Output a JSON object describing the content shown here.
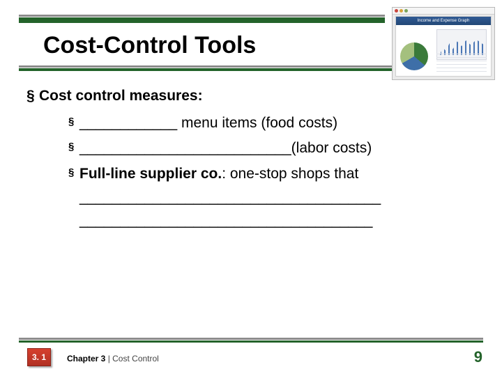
{
  "title": "Cost-Control Tools",
  "corner_image": {
    "window_title": "Income and Expense Graph"
  },
  "body": {
    "heading": "Cost control measures:",
    "items": [
      {
        "blank": "____________",
        "text_after": " menu items (food costs)"
      },
      {
        "blank": "__________________________",
        "text_after": "(labor costs)"
      },
      {
        "lead_bold": "Full-line supplier co.",
        "lead_tail": ": one-stop shops that",
        "fill_lines": [
          "_____________________________________",
          "____________________________________"
        ]
      }
    ]
  },
  "footer": {
    "badge": "3. 1",
    "chapter_bold": "Chapter 3",
    "chapter_tail": " | Cost Control",
    "page": "9"
  }
}
